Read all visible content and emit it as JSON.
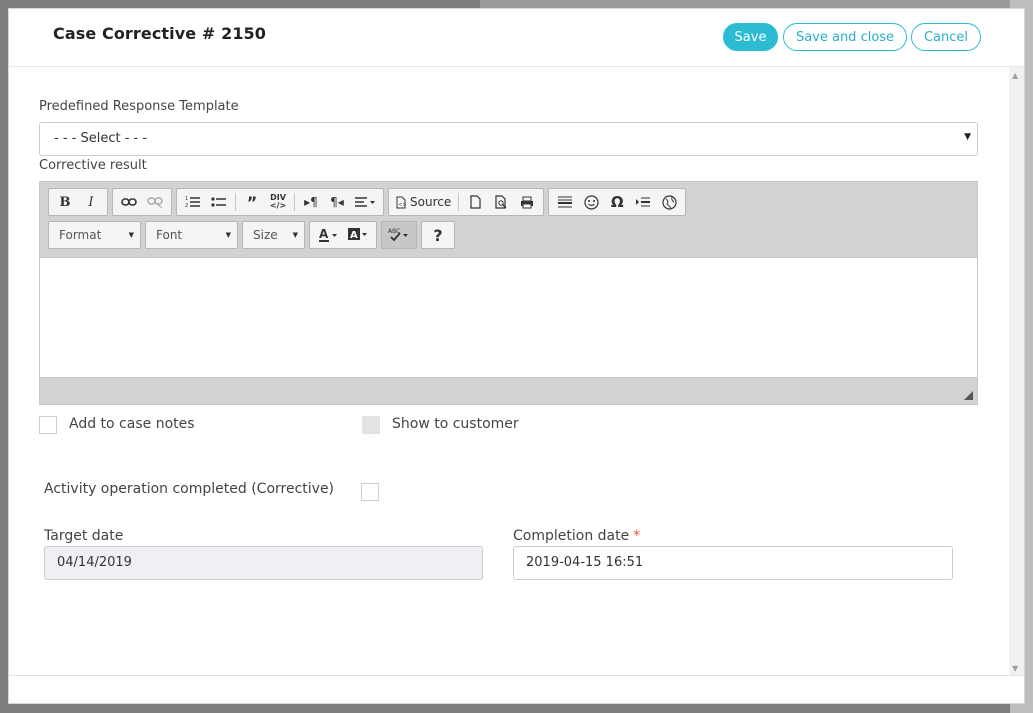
{
  "modal": {
    "title": "Case Corrective # 2150",
    "buttons": {
      "save": "Save",
      "save_close": "Save and close",
      "cancel": "Cancel"
    },
    "accent_color": "#2bbcd4"
  },
  "form": {
    "template_label": "Predefined Response Template",
    "template_value": "- - - Select - - -",
    "corrective_label": "Corrective result",
    "add_notes_label": "Add to case notes",
    "show_customer_label": "Show to customer",
    "activity_label": "Activity operation completed (Corrective)",
    "target_date_label": "Target date",
    "target_date_value": "04/14/2019",
    "completion_date_label": "Completion date",
    "completion_required": "*",
    "completion_date_value": "2019-04-15 16:51"
  },
  "editor": {
    "source_label": "Source",
    "format_label": "Format",
    "font_label": "Font",
    "size_label": "Size",
    "help_label": "?"
  }
}
